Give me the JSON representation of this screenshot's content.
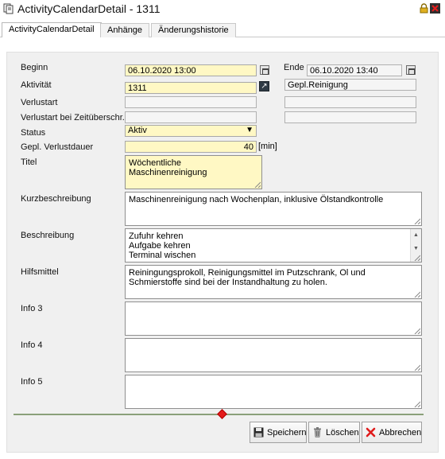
{
  "window": {
    "title": "ActivityCalendarDetail - 1311"
  },
  "tabs": [
    {
      "label": "ActivityCalendarDetail",
      "active": true
    },
    {
      "label": "Anhänge",
      "active": false
    },
    {
      "label": "Änderungshistorie",
      "active": false
    }
  ],
  "form": {
    "begin_label": "Beginn",
    "begin_value": "06.10.2020 13:00",
    "end_label": "Ende",
    "end_value": "06.10.2020 13:40",
    "activity_label": "Aktivität",
    "activity_value": "1311",
    "activity_name": "Gepl.Reinigung",
    "loss_type_label": "Verlustart",
    "loss_type_value": "",
    "loss_type_exceed_label": "Verlustart bei Zeitüberschr.",
    "loss_type_exceed_value": "",
    "status_label": "Status",
    "status_value": "Aktiv",
    "planned_loss_label": "Gepl. Verlustdauer",
    "planned_loss_value": "40",
    "planned_loss_unit": "[min]",
    "title_label": "Titel",
    "title_value": "Wöchentliche Maschinenreinigung",
    "short_desc_label": "Kurzbeschreibung",
    "short_desc_value": "Maschinenreinigung nach Wochenplan, inklusive Ölstandkontrolle",
    "desc_label": "Beschreibung",
    "desc_lines": [
      "Zufuhr kehren",
      "Aufgabe kehren",
      "Terminal wischen"
    ],
    "aids_label": "Hilfsmittel",
    "aids_value": "Reiningungsprokoll, Reinigungsmittel im Putzschrank, Ol und Schmierstoffe sind bei der Instandhaltung zu holen.",
    "info3_label": "Info 3",
    "info3_value": "",
    "info4_label": "Info 4",
    "info4_value": "",
    "info5_label": "Info 5",
    "info5_value": ""
  },
  "buttons": {
    "save": "Speichern",
    "delete": "Löschen",
    "cancel": "Abbrechen"
  },
  "colors": {
    "mandatory_field": "#fff8c4",
    "panel": "#f0f0f0",
    "splitter_handle": "#e41b1b"
  }
}
